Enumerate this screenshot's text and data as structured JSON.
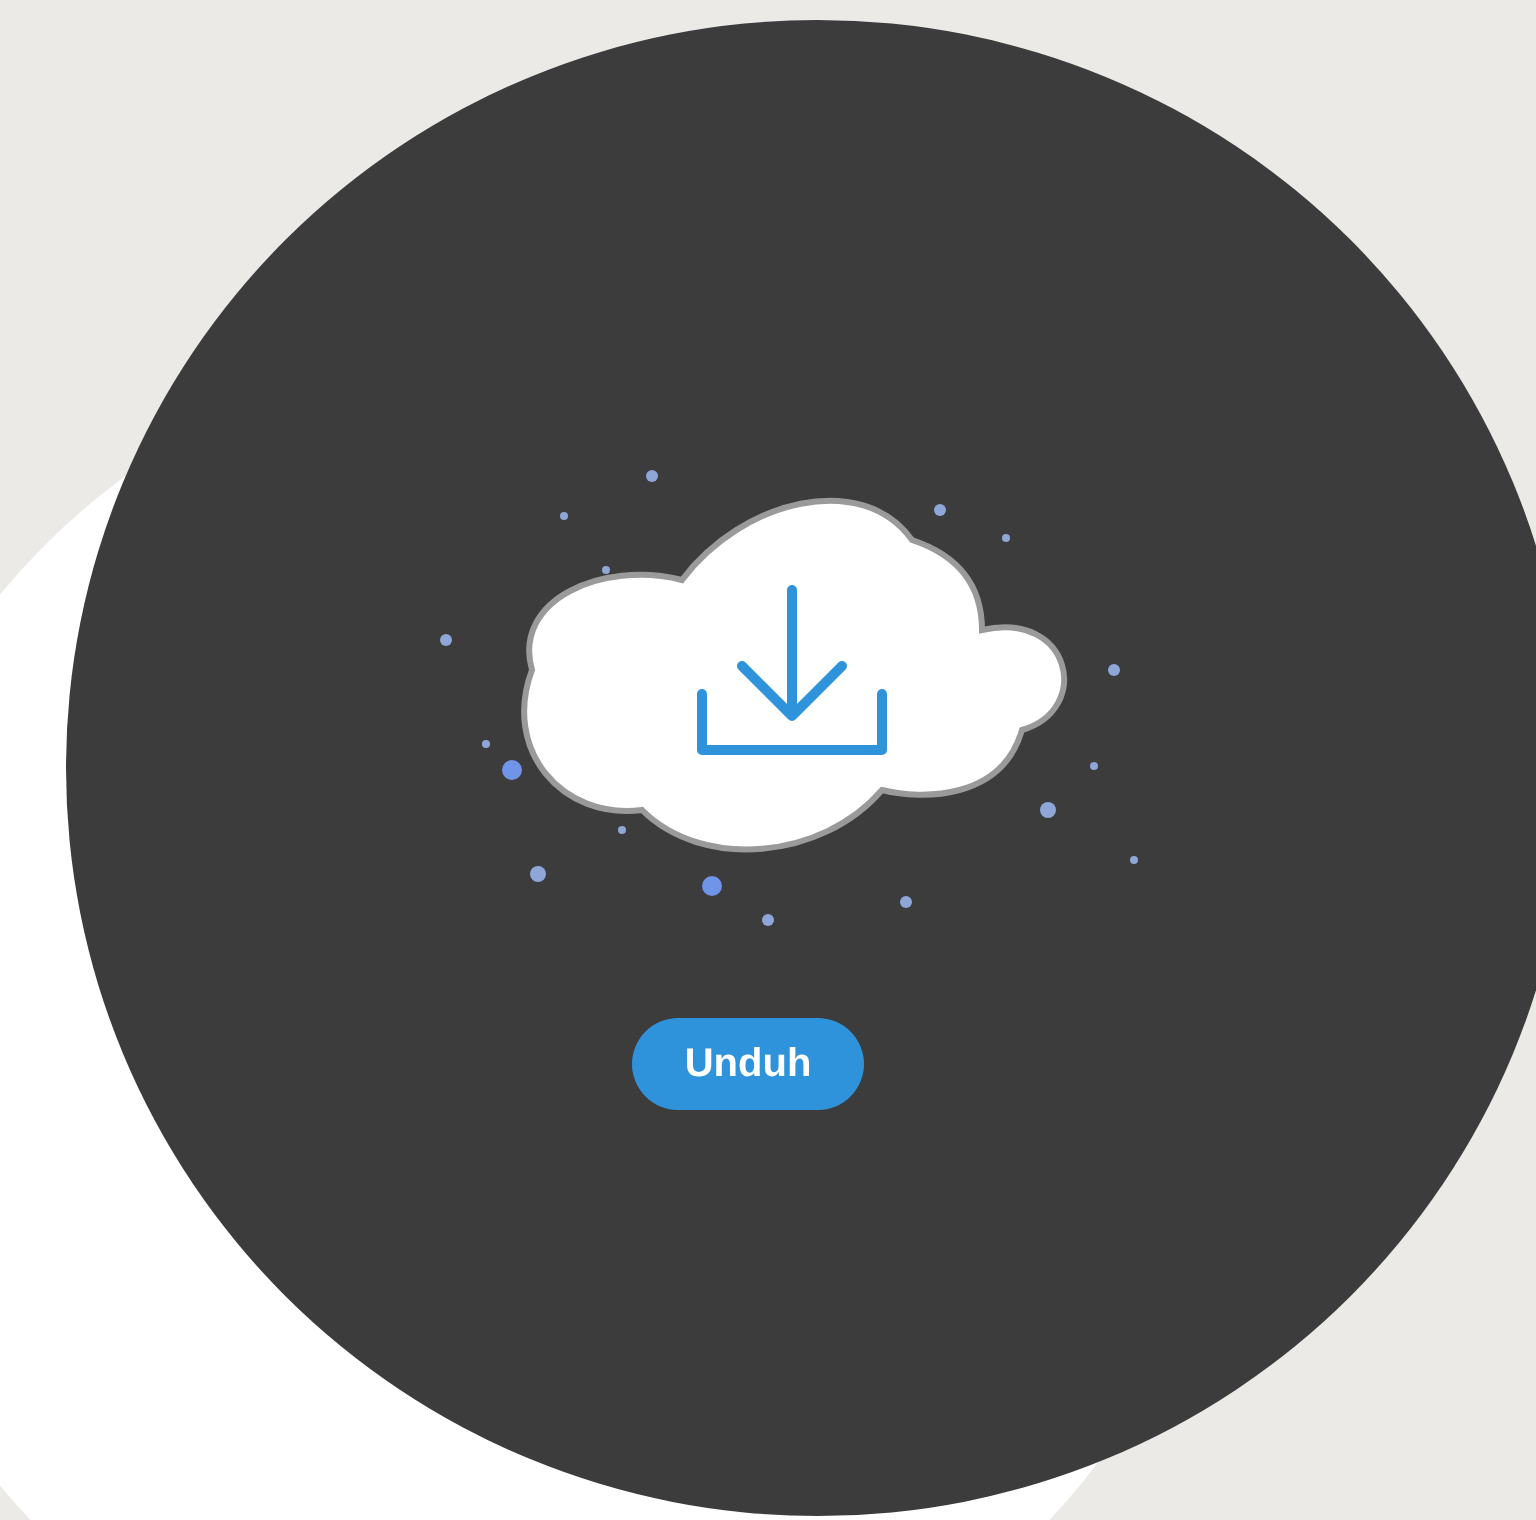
{
  "button": {
    "label": "Unduh"
  }
}
